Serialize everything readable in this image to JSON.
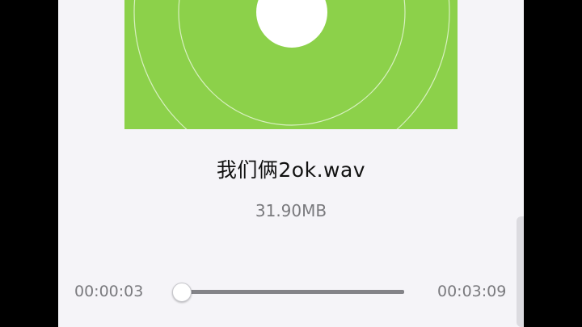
{
  "player": {
    "title": "我们俩2ok.wav",
    "file_size": "31.90MB",
    "elapsed": "00:00:03",
    "duration": "00:03:09",
    "progress_fraction": 0.016
  },
  "artwork": {
    "icon": "music-disc-artwork",
    "background_color": "#8cd14a",
    "ring_color": "#d8f0c0",
    "center_color": "#ffffff"
  },
  "colors": {
    "screen_background": "#f5f4f8",
    "seek_track": "#838388",
    "seek_progress": "#2d9cf0"
  }
}
